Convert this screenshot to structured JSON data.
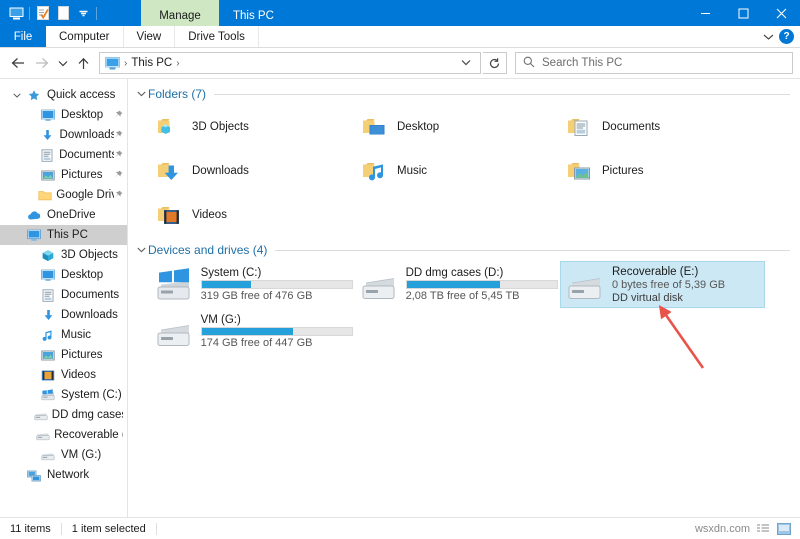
{
  "titlebar": {
    "quick_access": [
      {
        "name": "this-pc-icon",
        "label": "This PC"
      },
      {
        "name": "properties-icon",
        "label": "Properties"
      },
      {
        "name": "new-folder-icon",
        "label": "New folder"
      },
      {
        "name": "customize-dropdown-icon",
        "label": "Customize Quick Access Toolbar"
      }
    ],
    "contextual_tab": "Manage",
    "title": "This PC",
    "minimize": "–",
    "maximize": "□",
    "close": "✕"
  },
  "ribbon": {
    "file_tab": "File",
    "tabs": [
      "Computer",
      "View",
      "Drive Tools"
    ],
    "collapse_chevron": "⌄",
    "help": "?"
  },
  "address": {
    "back": "←",
    "forward": "→",
    "recent": "⌄",
    "up": "↑",
    "crumb": "This PC",
    "separator": "›",
    "dropdown": "⌄",
    "refresh": "↻"
  },
  "search": {
    "icon": "⚲",
    "placeholder": "Search This PC"
  },
  "sidebar": {
    "items": [
      {
        "label": "Quick access",
        "icon": "star-icon",
        "indent": 0,
        "chevron": "⌄",
        "pinned": false,
        "selected": false
      },
      {
        "label": "Desktop",
        "icon": "desktop-icon",
        "indent": 2,
        "chevron": "",
        "pinned": true,
        "selected": false
      },
      {
        "label": "Downloads",
        "icon": "downloads-icon",
        "indent": 2,
        "chevron": "",
        "pinned": true,
        "selected": false
      },
      {
        "label": "Documents",
        "icon": "documents-icon",
        "indent": 2,
        "chevron": "",
        "pinned": true,
        "selected": false
      },
      {
        "label": "Pictures",
        "icon": "pictures-icon",
        "indent": 2,
        "chevron": "",
        "pinned": true,
        "selected": false
      },
      {
        "label": "Google Drive",
        "icon": "folder-icon",
        "indent": 2,
        "chevron": "",
        "pinned": true,
        "selected": false
      },
      {
        "label": "OneDrive",
        "icon": "onedrive-icon",
        "indent": 0,
        "chevron": "",
        "pinned": false,
        "selected": false
      },
      {
        "label": "This PC",
        "icon": "this-pc-icon",
        "indent": 0,
        "chevron": "",
        "pinned": false,
        "selected": true
      },
      {
        "label": "3D Objects",
        "icon": "3d-objects-icon",
        "indent": 2,
        "chevron": "",
        "pinned": false,
        "selected": false
      },
      {
        "label": "Desktop",
        "icon": "desktop-icon",
        "indent": 2,
        "chevron": "",
        "pinned": false,
        "selected": false
      },
      {
        "label": "Documents",
        "icon": "documents-icon",
        "indent": 2,
        "chevron": "",
        "pinned": false,
        "selected": false
      },
      {
        "label": "Downloads",
        "icon": "downloads-icon",
        "indent": 2,
        "chevron": "",
        "pinned": false,
        "selected": false
      },
      {
        "label": "Music",
        "icon": "music-icon",
        "indent": 2,
        "chevron": "",
        "pinned": false,
        "selected": false
      },
      {
        "label": "Pictures",
        "icon": "pictures-icon",
        "indent": 2,
        "chevron": "",
        "pinned": false,
        "selected": false
      },
      {
        "label": "Videos",
        "icon": "videos-icon",
        "indent": 2,
        "chevron": "",
        "pinned": false,
        "selected": false
      },
      {
        "label": "System (C:)",
        "icon": "windows-drive-icon",
        "indent": 2,
        "chevron": "",
        "pinned": false,
        "selected": false
      },
      {
        "label": "DD dmg cases (D:)",
        "icon": "drive-icon",
        "indent": 2,
        "chevron": "",
        "pinned": false,
        "selected": false
      },
      {
        "label": "Recoverable (E:)",
        "icon": "drive-icon",
        "indent": 2,
        "chevron": "",
        "pinned": false,
        "selected": false
      },
      {
        "label": "VM (G:)",
        "icon": "drive-icon",
        "indent": 2,
        "chevron": "",
        "pinned": false,
        "selected": false
      },
      {
        "label": "Network",
        "icon": "network-icon",
        "indent": 0,
        "chevron": "",
        "pinned": false,
        "selected": false
      }
    ]
  },
  "main": {
    "groups": [
      {
        "title": "Folders (7)",
        "chevron": "⌄",
        "folders": [
          {
            "label": "3D Objects",
            "icon": "folder-3d-objects-icon"
          },
          {
            "label": "Desktop",
            "icon": "folder-desktop-icon"
          },
          {
            "label": "Documents",
            "icon": "folder-documents-icon"
          },
          {
            "label": "Downloads",
            "icon": "folder-downloads-icon"
          },
          {
            "label": "Music",
            "icon": "folder-music-icon"
          },
          {
            "label": "Pictures",
            "icon": "folder-pictures-icon"
          },
          {
            "label": "Videos",
            "icon": "folder-videos-icon"
          }
        ]
      },
      {
        "title": "Devices and drives (4)",
        "chevron": "⌄",
        "drives": [
          {
            "name": "System (C:)",
            "icon": "windows-drive-icon",
            "free_text": "319 GB free of 476 GB",
            "used_percent": 33,
            "has_bar": true,
            "extra": "",
            "selected": false
          },
          {
            "name": "DD dmg cases (D:)",
            "icon": "drive-icon",
            "free_text": "2,08 TB free of 5,45 TB",
            "used_percent": 62,
            "has_bar": true,
            "extra": "",
            "selected": false
          },
          {
            "name": "Recoverable (E:)",
            "icon": "drive-icon",
            "free_text": "0 bytes free of 5,39 GB",
            "used_percent": 100,
            "has_bar": false,
            "extra": "DD virtual disk",
            "selected": true
          },
          {
            "name": "VM (G:)",
            "icon": "drive-icon",
            "free_text": "174 GB free of 447 GB",
            "used_percent": 61,
            "has_bar": true,
            "extra": "",
            "selected": false
          }
        ]
      }
    ]
  },
  "statusbar": {
    "item_count": "11 items",
    "selection": "1 item selected",
    "watermark": "wsxdn.com",
    "view_details": "details-view-icon",
    "view_large": "large-icons-view-icon"
  },
  "annotation": {
    "arrow_color": "#e8544a",
    "description": "red arrow pointing to Recoverable (E:) drive"
  },
  "colors": {
    "accent": "#0078d7",
    "selection": "#cce8f4",
    "bar_fill": "#26a0da",
    "group_title": "#1f6fa5",
    "contextual_tab": "#cfe8c3"
  }
}
